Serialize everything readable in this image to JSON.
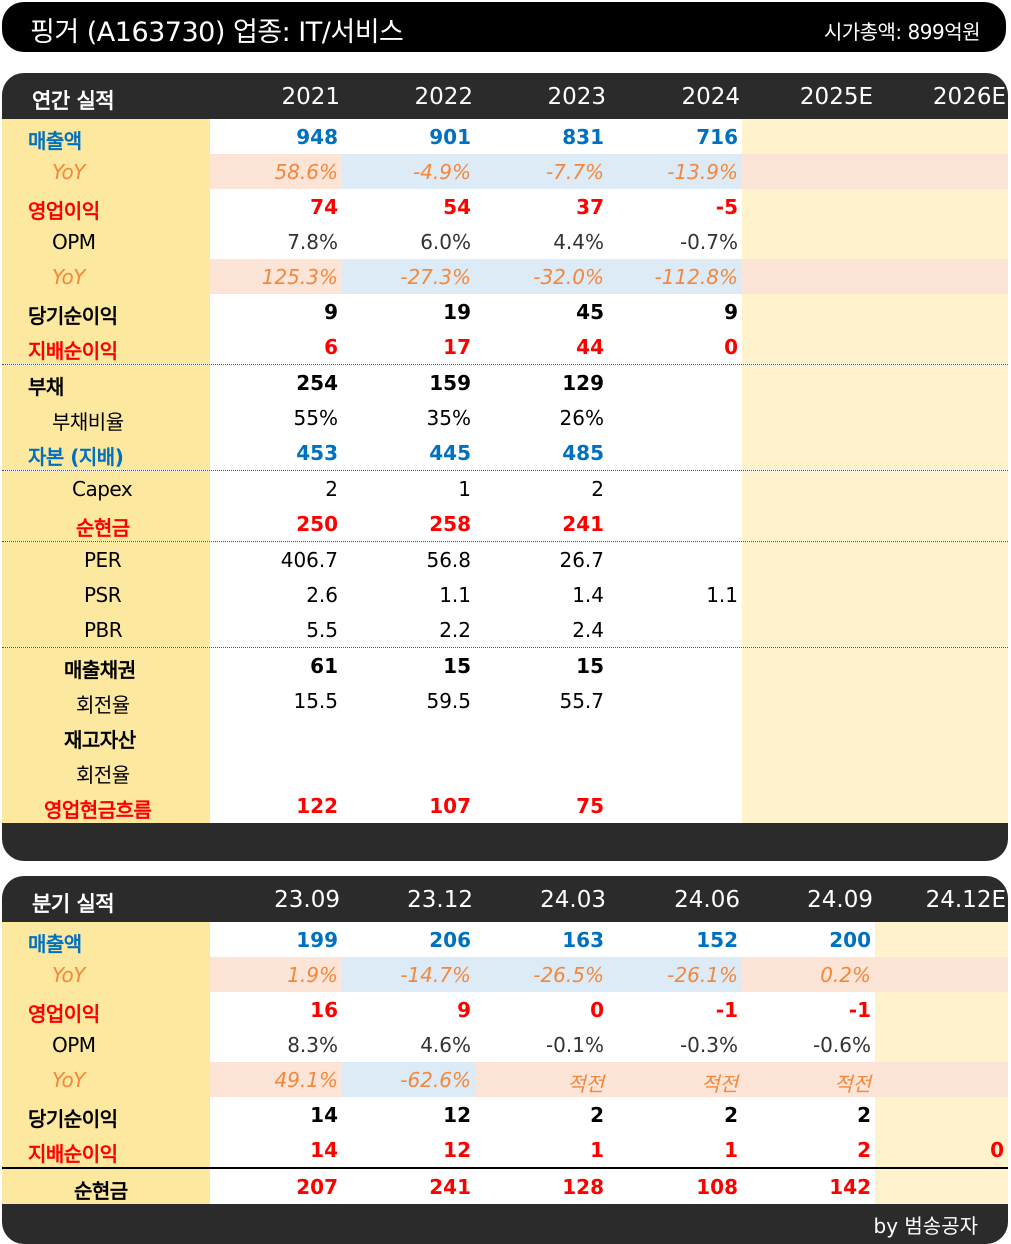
{
  "title": "핑거 (A163730) 업종: IT/서비스",
  "market_cap": "시가총액: 899억원",
  "annual": {
    "header_label": "연간 실적",
    "columns": [
      "2021",
      "2022",
      "2023",
      "2024",
      "2025E",
      "2026E"
    ],
    "rows": [
      {
        "label": "매출액",
        "values": [
          "948",
          "901",
          "831",
          "716",
          "",
          ""
        ]
      },
      {
        "label": "YoY",
        "values": [
          "58.6%",
          "-4.9%",
          "-7.7%",
          "-13.9%",
          "",
          ""
        ]
      },
      {
        "label": "영업이익",
        "values": [
          "74",
          "54",
          "37",
          "-5",
          "",
          ""
        ]
      },
      {
        "label": "OPM",
        "values": [
          "7.8%",
          "6.0%",
          "4.4%",
          "-0.7%",
          "",
          ""
        ]
      },
      {
        "label": "YoY",
        "values": [
          "125.3%",
          "-27.3%",
          "-32.0%",
          "-112.8%",
          "",
          ""
        ]
      },
      {
        "label": "당기순이익",
        "values": [
          "9",
          "19",
          "45",
          "9",
          "",
          ""
        ]
      },
      {
        "label": "지배순이익",
        "values": [
          "6",
          "17",
          "44",
          "0",
          "",
          ""
        ]
      },
      {
        "label": "부채",
        "values": [
          "254",
          "159",
          "129",
          "",
          "",
          ""
        ]
      },
      {
        "label": "부채비율",
        "values": [
          "55%",
          "35%",
          "26%",
          "",
          "",
          ""
        ]
      },
      {
        "label": "자본 (지배)",
        "values": [
          "453",
          "445",
          "485",
          "",
          "",
          ""
        ]
      },
      {
        "label": "Capex",
        "values": [
          "2",
          "1",
          "2",
          "",
          "",
          ""
        ]
      },
      {
        "label": "순현금",
        "values": [
          "250",
          "258",
          "241",
          "",
          "",
          ""
        ]
      },
      {
        "label": "PER",
        "values": [
          "406.7",
          "56.8",
          "26.7",
          "",
          "",
          ""
        ]
      },
      {
        "label": "PSR",
        "values": [
          "2.6",
          "1.1",
          "1.4",
          "1.1",
          "",
          ""
        ]
      },
      {
        "label": "PBR",
        "values": [
          "5.5",
          "2.2",
          "2.4",
          "",
          "",
          ""
        ]
      },
      {
        "label": "매출채권",
        "values": [
          "61",
          "15",
          "15",
          "",
          "",
          ""
        ]
      },
      {
        "label": "회전율",
        "values": [
          "15.5",
          "59.5",
          "55.7",
          "",
          "",
          ""
        ]
      },
      {
        "label": "재고자산",
        "values": [
          "",
          "",
          "",
          "",
          "",
          ""
        ]
      },
      {
        "label": "회전율",
        "values": [
          "",
          "",
          "",
          "",
          "",
          ""
        ]
      },
      {
        "label": "영업현금흐름",
        "values": [
          "122",
          "107",
          "75",
          "",
          "",
          ""
        ]
      }
    ]
  },
  "quarterly": {
    "header_label": "분기 실적",
    "columns": [
      "23.09",
      "23.12",
      "24.03",
      "24.06",
      "24.09",
      "24.12E"
    ],
    "rows": [
      {
        "label": "매출액",
        "values": [
          "199",
          "206",
          "163",
          "152",
          "200",
          ""
        ]
      },
      {
        "label": "YoY",
        "values": [
          "1.9%",
          "-14.7%",
          "-26.5%",
          "-26.1%",
          "0.2%",
          ""
        ]
      },
      {
        "label": "영업이익",
        "values": [
          "16",
          "9",
          "0",
          "-1",
          "-1",
          ""
        ]
      },
      {
        "label": "OPM",
        "values": [
          "8.3%",
          "4.6%",
          "-0.1%",
          "-0.3%",
          "-0.6%",
          ""
        ]
      },
      {
        "label": "YoY",
        "values": [
          "49.1%",
          "-62.6%",
          "적전",
          "적전",
          "적전",
          ""
        ]
      },
      {
        "label": "당기순이익",
        "values": [
          "14",
          "12",
          "2",
          "2",
          "2",
          ""
        ]
      },
      {
        "label": "지배순이익",
        "values": [
          "14",
          "12",
          "1",
          "1",
          "2",
          "0"
        ]
      },
      {
        "label": "순현금",
        "values": [
          "207",
          "241",
          "128",
          "108",
          "142",
          ""
        ]
      }
    ]
  },
  "footer": "by 범송공자",
  "colors": {
    "label_bg": "#fde8a0",
    "forecast_bg": "#fef3cd",
    "header_bg": "#2b2b2b",
    "red": "#ff0000",
    "blue": "#0070c0",
    "orange": "#f4873c",
    "yoy_pink": "#fce4d6",
    "yoy_blue": "#ddebf7"
  }
}
